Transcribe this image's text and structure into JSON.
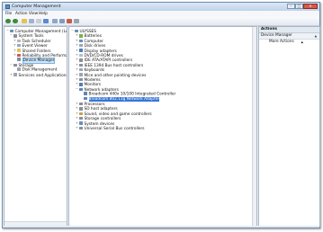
{
  "window": {
    "title": "Computer Management"
  },
  "menu": [
    "File",
    "Action",
    "View",
    "Help"
  ],
  "left_tree": [
    {
      "label": "Computer Management (Local",
      "indent": 0,
      "expander": "−",
      "icon_color": "#6b8fb7"
    },
    {
      "label": "System Tools",
      "indent": 1,
      "expander": "−",
      "icon_color": "#8a8f99"
    },
    {
      "label": "Task Scheduler",
      "indent": 2,
      "expander": "+",
      "icon_color": "#b7b7b7"
    },
    {
      "label": "Event Viewer",
      "indent": 2,
      "expander": "+",
      "icon_color": "#8fa8c6"
    },
    {
      "label": "Shared Folders",
      "indent": 2,
      "expander": "+",
      "icon_color": "#e3c15a"
    },
    {
      "label": "Reliability and Performa",
      "indent": 2,
      "expander": "+",
      "icon_color": "#d15b4c"
    },
    {
      "label": "Device Manager",
      "indent": 2,
      "expander": "",
      "icon_color": "#7a8fa8",
      "selected": true
    },
    {
      "label": "Storage",
      "indent": 1,
      "expander": "−",
      "icon_color": "#8a8f99"
    },
    {
      "label": "Disk Management",
      "indent": 2,
      "expander": "",
      "icon_color": "#9aa5b3"
    },
    {
      "label": "Services and Applications",
      "indent": 1,
      "expander": "+",
      "icon_color": "#9aa5b3"
    }
  ],
  "device_tree": [
    {
      "label": "ULYSSES",
      "indent": 0,
      "expander": "−",
      "icon_color": "#6b8fb7"
    },
    {
      "label": "Batteries",
      "indent": 1,
      "expander": "+",
      "icon_color": "#7bb04a"
    },
    {
      "label": "Computer",
      "indent": 1,
      "expander": "+",
      "icon_color": "#6b8fb7"
    },
    {
      "label": "Disk drives",
      "indent": 1,
      "expander": "+",
      "icon_color": "#9aa5b3"
    },
    {
      "label": "Display adapters",
      "indent": 1,
      "expander": "+",
      "icon_color": "#4f7fb8"
    },
    {
      "label": "DVD/CD-ROM drives",
      "indent": 1,
      "expander": "+",
      "icon_color": "#b9bec6"
    },
    {
      "label": "IDE ATA/ATAPI controllers",
      "indent": 1,
      "expander": "+",
      "icon_color": "#8a8f99"
    },
    {
      "label": "IEEE 1394 Bus host controllers",
      "indent": 1,
      "expander": "+",
      "icon_color": "#8a8f99"
    },
    {
      "label": "Keyboards",
      "indent": 1,
      "expander": "+",
      "icon_color": "#9aa5b3"
    },
    {
      "label": "Mice and other pointing devices",
      "indent": 1,
      "expander": "+",
      "icon_color": "#9aa5b3"
    },
    {
      "label": "Modems",
      "indent": 1,
      "expander": "+",
      "icon_color": "#8a8f99"
    },
    {
      "label": "Monitors",
      "indent": 1,
      "expander": "+",
      "icon_color": "#4f7fb8"
    },
    {
      "label": "Network adapters",
      "indent": 1,
      "expander": "−",
      "icon_color": "#5e86b5"
    },
    {
      "label": "Broadcom 440x 10/100 Integrated Controller",
      "indent": 2,
      "expander": "",
      "icon_color": "#5e86b5"
    },
    {
      "label": "Broadcom 802.11g Network Adapter",
      "indent": 2,
      "expander": "",
      "icon_color": "#5e86b5",
      "selected": true
    },
    {
      "label": "Processors",
      "indent": 1,
      "expander": "+",
      "icon_color": "#8a8f99"
    },
    {
      "label": "SD host adapters",
      "indent": 1,
      "expander": "+",
      "icon_color": "#8a8f99"
    },
    {
      "label": "Sound, video and game controllers",
      "indent": 1,
      "expander": "+",
      "icon_color": "#c7a24e"
    },
    {
      "label": "Storage controllers",
      "indent": 1,
      "expander": "+",
      "icon_color": "#8a8f99"
    },
    {
      "label": "System devices",
      "indent": 1,
      "expander": "+",
      "icon_color": "#6b8fb7"
    },
    {
      "label": "Universal Serial Bus controllers",
      "indent": 1,
      "expander": "+",
      "icon_color": "#8a8f99"
    }
  ],
  "actions": {
    "header": "Actions",
    "section": "Device Manager",
    "section_arrow": "▲",
    "more": "More Actions",
    "more_arrow": "▶"
  },
  "toolbar_icons": [
    "back-icon",
    "forward-icon",
    "up-icon",
    "show-hide-tree-icon",
    "properties-icon",
    "help-icon",
    "scan-hardware-icon",
    "update-driver-icon",
    "uninstall-icon",
    "disable-icon"
  ],
  "window_controls": {
    "minimize": "–",
    "maximize": "□",
    "close": "✕"
  }
}
